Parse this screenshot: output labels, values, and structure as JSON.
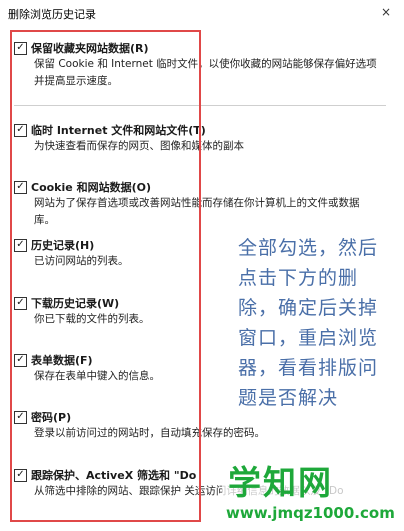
{
  "window": {
    "title": "删除浏览历史记录",
    "close_glyph": "×"
  },
  "options": [
    {
      "checked": true,
      "title": "保留收藏夹网站数据(R)",
      "desc": "保留 Cookie 和 Internet 临时文件，以使你收藏的网站能够保存偏好选项并提高显示速度。"
    },
    {
      "checked": true,
      "title": "临时 Internet 文件和网站文件(T)",
      "desc": "为快速查看而保存的网页、图像和媒体的副本"
    },
    {
      "checked": true,
      "title": "Cookie 和网站数据(O)",
      "desc": "网站为了保存首选项或改善网站性能而存储在你计算机上的文件或数据库。"
    },
    {
      "checked": true,
      "title": "历史记录(H)",
      "desc": "已访问网站的列表。"
    },
    {
      "checked": true,
      "title": "下载历史记录(W)",
      "desc": "你已下载的文件的列表。"
    },
    {
      "checked": true,
      "title": "表单数据(F)",
      "desc": "保存在表单中键入的信息。"
    },
    {
      "checked": true,
      "title": "密码(P)",
      "desc": "登录以前访问过的网站时，自动填充保存的密码。"
    },
    {
      "checked": true,
      "title": "跟踪保护、ActiveX 筛选和 \"Do",
      "desc": "从筛选中排除的网站、跟踪保护 关运访问详细信息的数据以及 \"Do"
    }
  ],
  "annotation": {
    "lines": [
      "全部勾选，然后",
      "点击下方的删",
      "除，确定后关掉",
      "窗口，重启浏览",
      "器，看看排版问",
      "题是否解决"
    ]
  },
  "watermark": {
    "main": "学知网",
    "url": "www.jmqz1000.com"
  },
  "colors": {
    "frame": "#e04848",
    "annotation": "#4a6fa8",
    "watermark": "#1ea83a"
  }
}
